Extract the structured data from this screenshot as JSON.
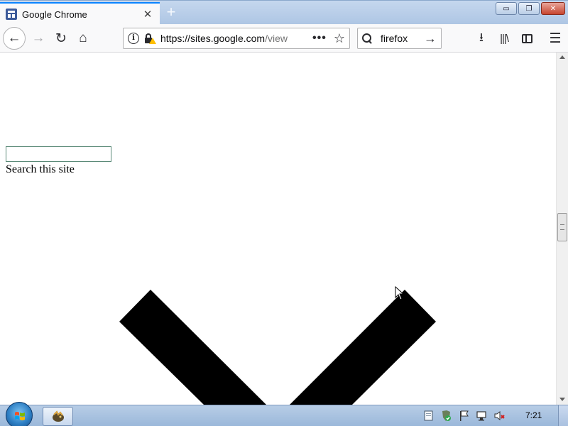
{
  "browser": {
    "tab": {
      "title": "Google Chrome",
      "favicon": "site-favicon-icon",
      "close_glyph": "✕"
    },
    "new_tab_glyph": "+",
    "window_buttons": {
      "minimize": "▭",
      "restore": "❐",
      "close": "✕"
    },
    "toolbar": {
      "back_glyph": "←",
      "forward_glyph": "→",
      "reload_glyph": "↻",
      "home_glyph": "⌂",
      "download_glyph": "⭳",
      "library_glyph": "|||\\",
      "menu_glyph": "☰"
    },
    "url_bar": {
      "url_main": "https://sites.google.com",
      "url_rest": "/view",
      "more_glyph": "•••",
      "bookmark_glyph": "☆"
    },
    "search_bar": {
      "value": "firefox",
      "go_glyph": "→"
    }
  },
  "page": {
    "search_input_value": "",
    "search_label": "Search this site",
    "chevron_color": "#000000"
  },
  "taskbar": {
    "clock": "7:21",
    "tray_icons": [
      "action-center-icon",
      "security-shield-icon",
      "flag-icon",
      "network-icon",
      "volume-muted-icon"
    ]
  },
  "colors": {
    "tab_accent": "#0a84ff",
    "taskbar": "#a9c3e2",
    "close_button": "#c7452f"
  }
}
